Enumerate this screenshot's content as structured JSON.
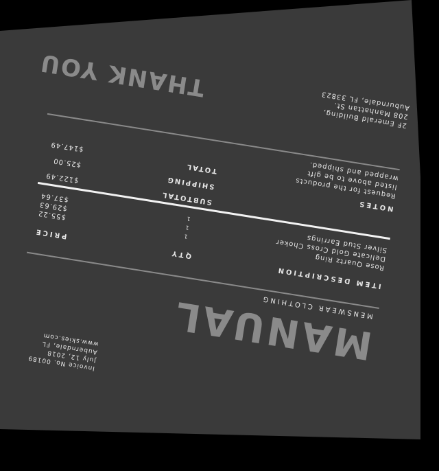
{
  "brand": {
    "name": "MANUAL",
    "tagline": "MENSWEAR CLOTHING"
  },
  "invoice_info": [
    "Invoice No. 00189",
    "July 12, 2018",
    "Auberndale, FL",
    "www.skies.com"
  ],
  "table": {
    "headers": {
      "description": "ITEM DESCRIPTION",
      "qty": "QTY",
      "price": "PRICE"
    },
    "items": [
      {
        "description": "Rose Quartz Ring",
        "qty": "1",
        "price": "$55.22"
      },
      {
        "description": "Delicate Gold Cross Choker",
        "qty": "1",
        "price": "$29.63"
      },
      {
        "description": "Silver Stud Earrings",
        "qty": "1",
        "price": "$37.64"
      }
    ]
  },
  "totals": {
    "subtotal_label": "SUBTOTAL",
    "subtotal_value": "$122.49",
    "shipping_label": "SHIPPING",
    "shipping_value": "$25.00",
    "total_label": "TOTAL",
    "total_value": "$147.49"
  },
  "notes": {
    "title": "NOTES",
    "lines": [
      "Request for the products",
      "listed above to be gift",
      "wrapped and shipped."
    ]
  },
  "thank_you": "THANK YOU",
  "address": [
    "2F Emerald Building,",
    "208 Manhattan St.",
    "Auburndale, FL 33823"
  ]
}
